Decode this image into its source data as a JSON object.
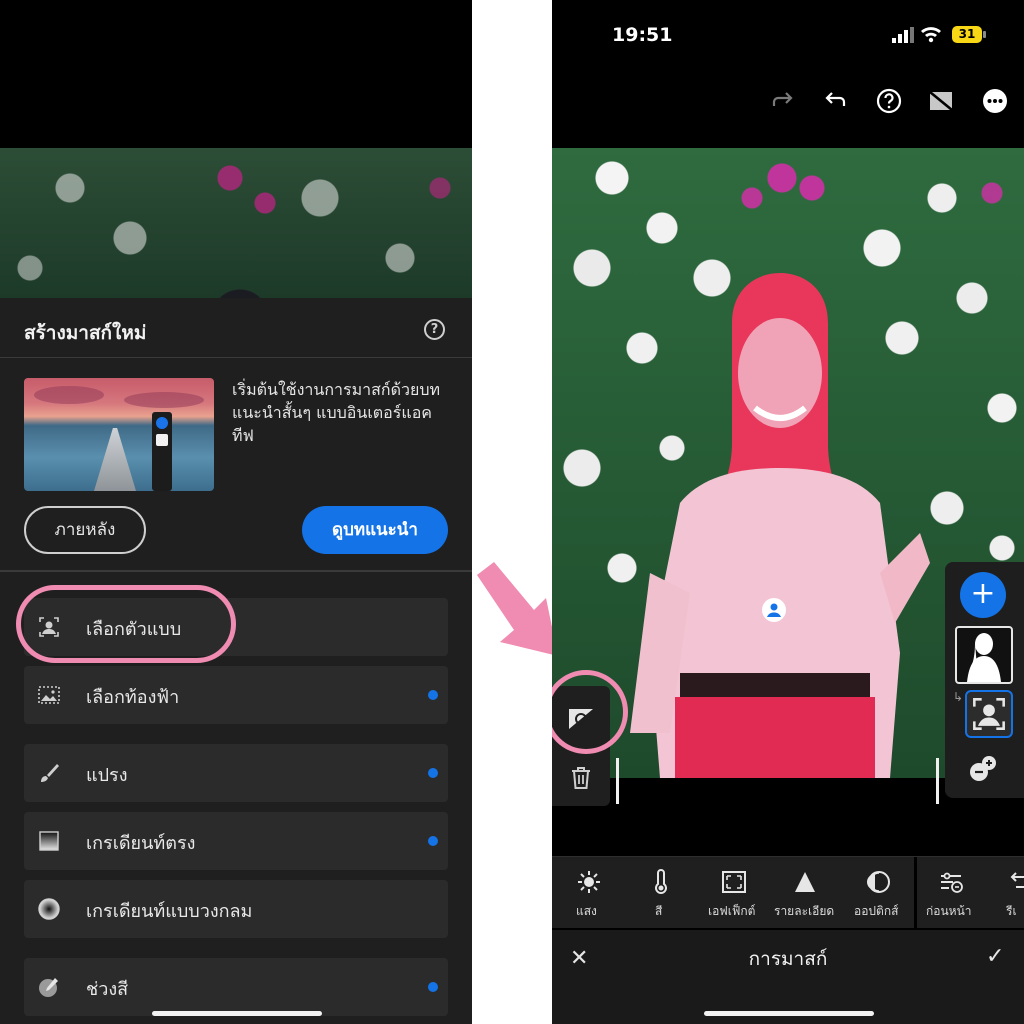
{
  "left_screen": {
    "sheet_title": "สร้างมาสก์ใหม่",
    "help_icon": "question-circle-icon",
    "tutorial": {
      "text": "เริ่มต้นใช้งานการมาสก์ด้วยบทแนะนำสั้นๆ แบบอินเตอร์แอคทีฟ",
      "later_label": "ภายหลัง",
      "view_label": "ดูบทแนะนำ"
    },
    "mask_options": [
      {
        "label": "เลือกตัวแบบ",
        "icon": "subject-icon",
        "new": false
      },
      {
        "label": "เลือกท้องฟ้า",
        "icon": "sky-icon",
        "new": true
      },
      {
        "label": "แปรง",
        "icon": "brush-icon",
        "new": true
      },
      {
        "label": "เกรเดียนท์ตรง",
        "icon": "linear-gradient-icon",
        "new": true
      },
      {
        "label": "เกรเดียนท์แบบวงกลม",
        "icon": "radial-gradient-icon",
        "new": true
      },
      {
        "label": "ช่วงสี",
        "icon": "color-range-icon",
        "new": true
      }
    ]
  },
  "right_screen": {
    "status": {
      "time": "19:51",
      "battery": "31"
    },
    "top_icons": [
      "redo-icon",
      "undo-icon",
      "help-icon",
      "compare-icon",
      "more-icon"
    ],
    "adjustments": [
      {
        "label": "แสง",
        "icon": "sun-icon"
      },
      {
        "label": "สี",
        "icon": "thermometer-icon"
      },
      {
        "label": "เอฟเฟ็กต์",
        "icon": "effects-icon"
      },
      {
        "label": "รายละเอียด",
        "icon": "triangle-icon"
      },
      {
        "label": "ออปติกส์",
        "icon": "optics-icon"
      },
      {
        "label": "ก่อนหน้า",
        "icon": "previous-icon"
      },
      {
        "label": "รีเ",
        "icon": "reset-icon"
      }
    ],
    "bottom_title": "การมาสก์"
  },
  "colors": {
    "accent": "#1473e6",
    "highlight": "#f08bb1",
    "mask_overlay": "#e8375a"
  }
}
